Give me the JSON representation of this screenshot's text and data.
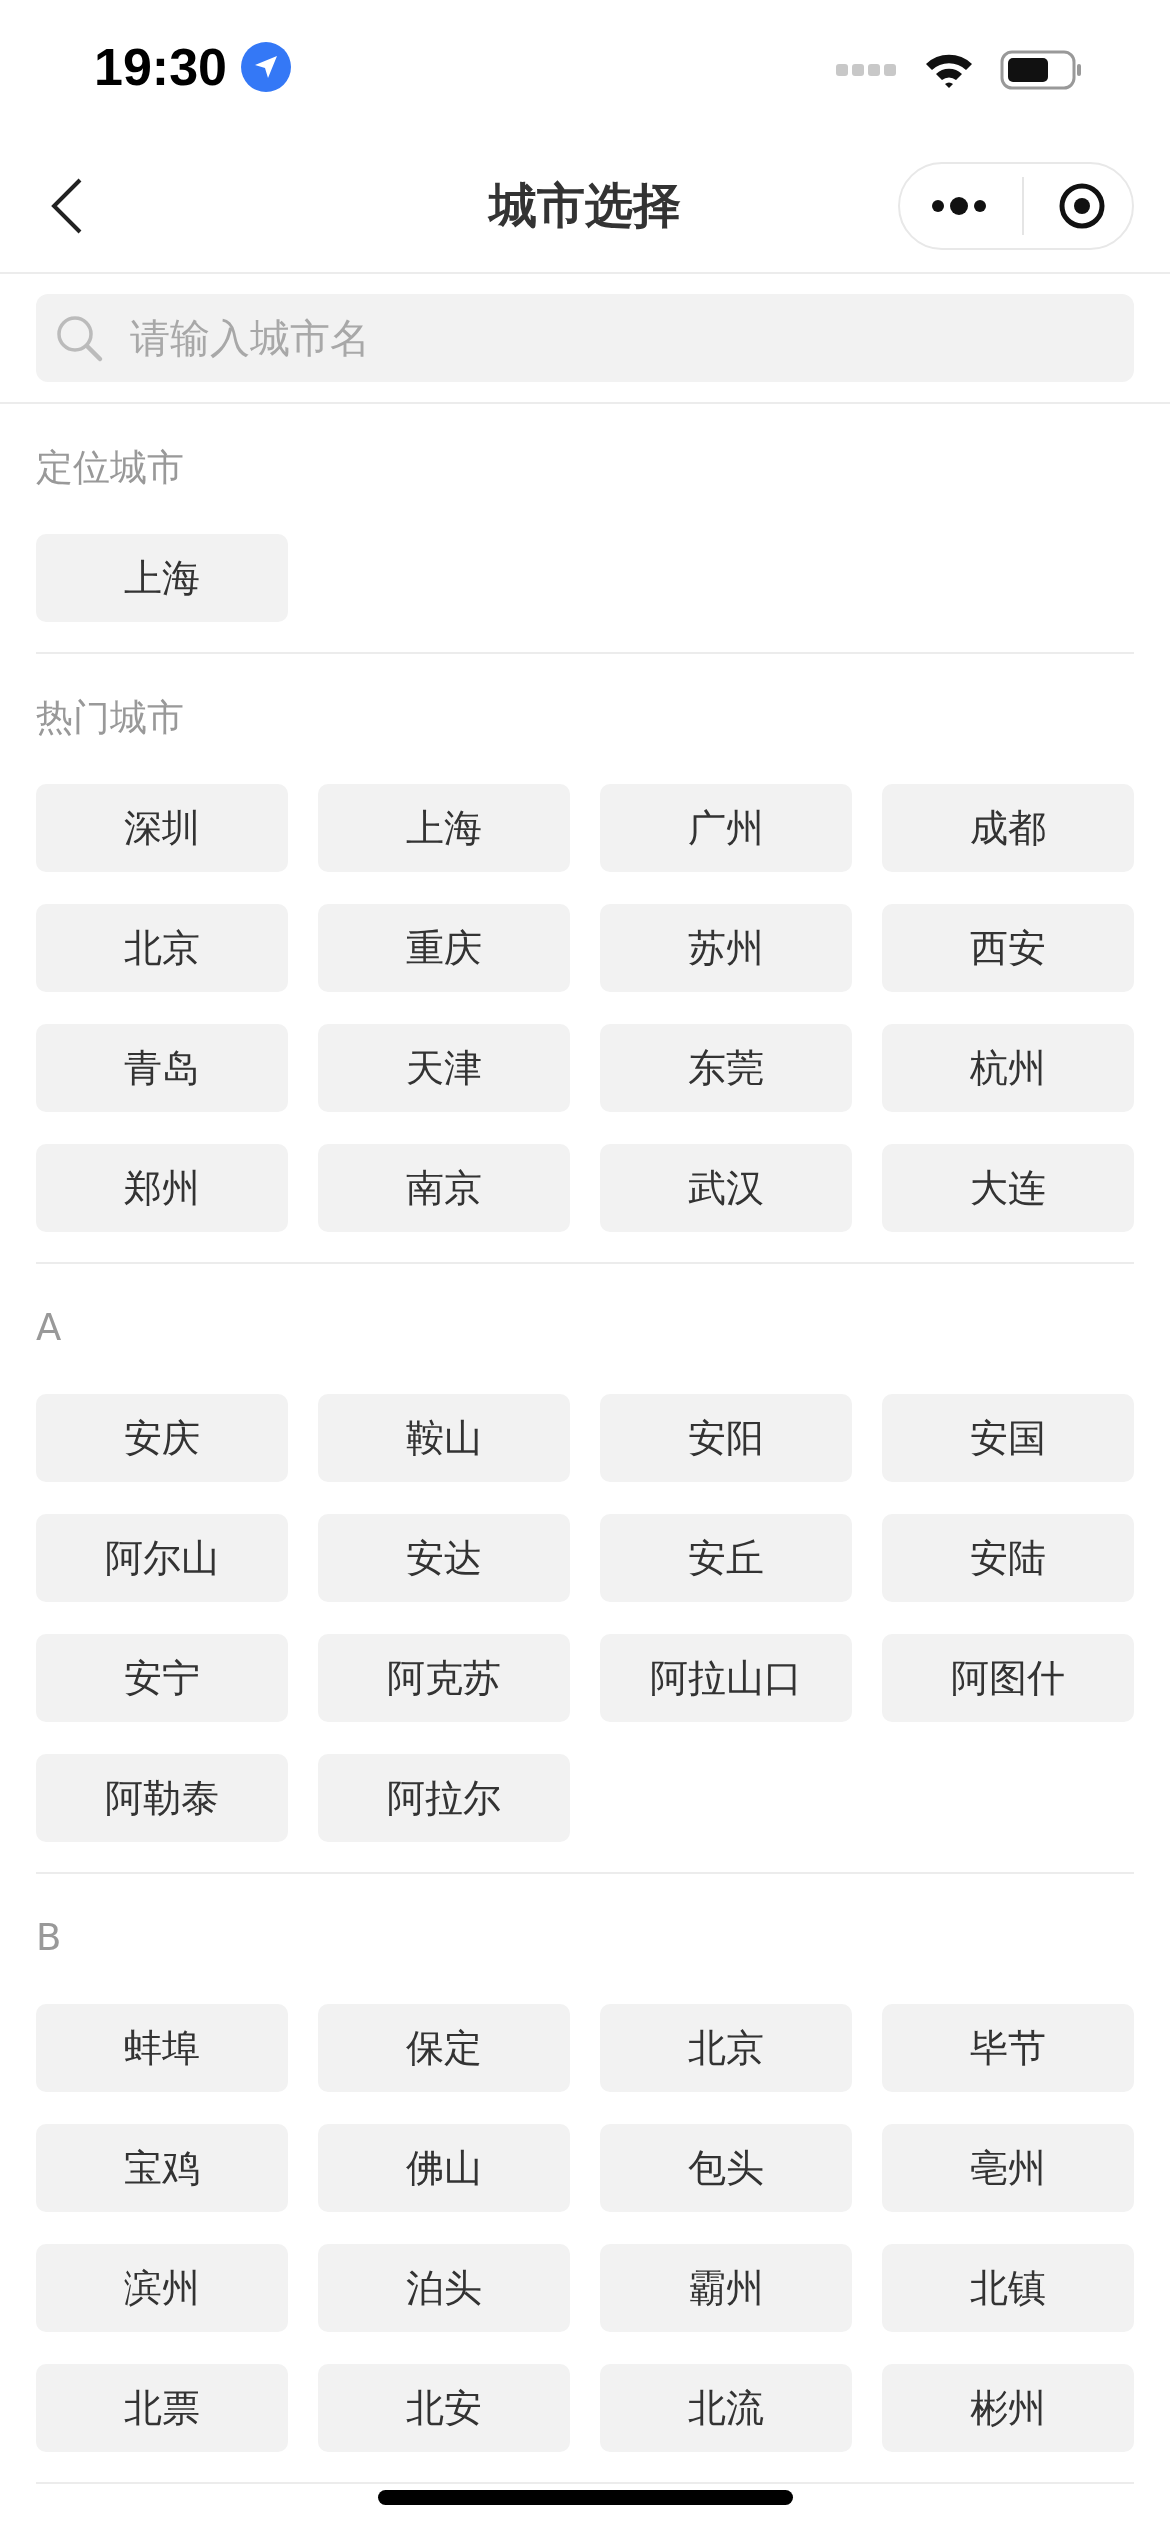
{
  "status_bar": {
    "time": "19:30"
  },
  "nav": {
    "title": "城市选择"
  },
  "search": {
    "placeholder": "请输入城市名"
  },
  "sections": [
    {
      "title": "定位城市",
      "cities": [
        "上海"
      ]
    },
    {
      "title": "热门城市",
      "cities": [
        "深圳",
        "上海",
        "广州",
        "成都",
        "北京",
        "重庆",
        "苏州",
        "西安",
        "青岛",
        "天津",
        "东莞",
        "杭州",
        "郑州",
        "南京",
        "武汉",
        "大连"
      ]
    },
    {
      "title": "A",
      "cities": [
        "安庆",
        "鞍山",
        "安阳",
        "安国",
        "阿尔山",
        "安达",
        "安丘",
        "安陆",
        "安宁",
        "阿克苏",
        "阿拉山口",
        "阿图什",
        "阿勒泰",
        "阿拉尔"
      ]
    },
    {
      "title": "B",
      "cities": [
        "蚌埠",
        "保定",
        "北京",
        "毕节",
        "宝鸡",
        "佛山",
        "包头",
        "亳州",
        "滨州",
        "泊头",
        "霸州",
        "北镇",
        "北票",
        "北安",
        "北流",
        "彬州"
      ]
    }
  ]
}
